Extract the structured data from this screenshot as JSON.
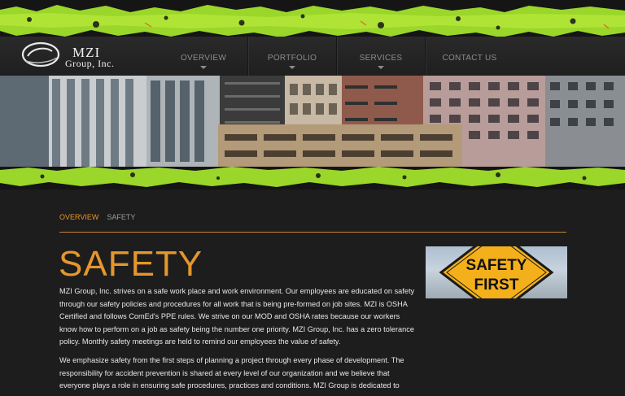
{
  "brand": {
    "name_line1": "MZI",
    "name_line2": "Group, Inc."
  },
  "nav": {
    "items": [
      {
        "label": "OVERVIEW",
        "has_dropdown": true
      },
      {
        "label": "PORTFOLIO",
        "has_dropdown": true
      },
      {
        "label": "SERVICES",
        "has_dropdown": true
      },
      {
        "label": "CONTACT US",
        "has_dropdown": false
      }
    ]
  },
  "breadcrumb": {
    "items": [
      "OVERVIEW",
      "SAFETY"
    ]
  },
  "page": {
    "title": "SAFETY",
    "paragraphs": [
      "MZI Group, Inc. strives on a safe work place and work environment. Our employees are educated on safety through our safety policies and procedures for all work that is being pre-formed on job sites. MZI is OSHA Certified and follows ComEd's PPE rules. We strive on our MOD and OSHA rates because our workers know how to perform on a job as safety being the number one priority. MZI Group, Inc. has a zero tolerance policy. Monthly safety meetings are held to remind our employees the value of safety.",
      "We emphasize safety from the first steps of planning a project through every phase of development. The responsibility for accident prevention is shared at every level of our organization and we believe that everyone plays a role in ensuring safe procedures, practices and conditions. MZI Group is dedicated to"
    ]
  },
  "sign": {
    "line1": "SAFETY",
    "line2": "FIRST"
  },
  "colors": {
    "accent": "#e6962c",
    "grunge_green": "#9bd62a",
    "background": "#1d1d1d",
    "sign_yellow": "#f4b01b"
  }
}
